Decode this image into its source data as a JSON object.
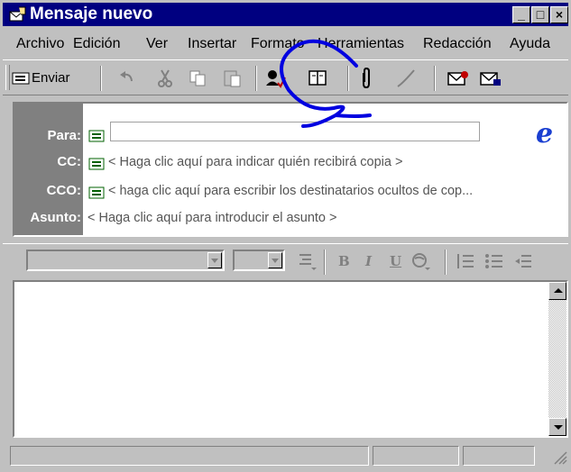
{
  "window": {
    "title": "Mensaje nuevo",
    "controls": [
      "minimize",
      "maximize",
      "close"
    ]
  },
  "menu": [
    {
      "label": "Archivo"
    },
    {
      "label": "Edición"
    },
    {
      "label": "Ver"
    },
    {
      "label": "Insertar"
    },
    {
      "label": "Formato"
    },
    {
      "label": "Herramientas"
    },
    {
      "label": "Redacción"
    },
    {
      "label": "Ayuda"
    }
  ],
  "toolbar": {
    "send_label": "Enviar",
    "buttons": [
      "undo-icon",
      "cut-icon",
      "copy-icon",
      "paste-icon",
      "check-names-icon",
      "address-book-icon",
      "attach-icon",
      "signature-icon",
      "sign-message-icon",
      "encrypt-icon"
    ]
  },
  "header": {
    "to_label": "Para:",
    "to_value": "",
    "cc_label": "CC:",
    "cc_hint": "< Haga clic aquí para indicar quién recibirá copia >",
    "bcc_label": "CCO:",
    "bcc_hint": "< haga clic aquí para escribir los destinatarios ocultos de cop...",
    "subject_label": "Asunto:",
    "subject_hint": "< Haga clic aquí para introducir el asunto >",
    "logo_text": "e"
  },
  "format_toolbar": {
    "font_value": "",
    "size_value": "",
    "bold": "B",
    "italic": "I",
    "underline": "U"
  },
  "body": {
    "text": ""
  },
  "colors": {
    "titlebar": "#000080",
    "face": "#c0c0c0",
    "label_column": "#808080",
    "annotation": "#0000e0",
    "ie_logo": "#1a3fd1"
  }
}
